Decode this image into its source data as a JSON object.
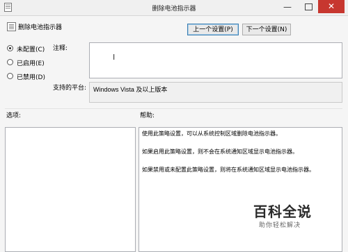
{
  "window": {
    "title": "删除电池指示器",
    "minimize_glyph": "—",
    "close_glyph": "✕"
  },
  "header": {
    "policy_name": "删除电池指示器",
    "prev_button": "上一个设置(P)",
    "next_button": "下一个设置(N)"
  },
  "state": {
    "options": [
      {
        "label": "未配置(C)",
        "selected": true
      },
      {
        "label": "已启用(E)",
        "selected": false
      },
      {
        "label": "已禁用(D)",
        "selected": false
      }
    ]
  },
  "comment": {
    "label": "注释:",
    "value": "",
    "cursor_glyph": "I"
  },
  "platform": {
    "label": "支持的平台:",
    "value": "Windows Vista 及以上版本"
  },
  "options_section": {
    "label": "选项:"
  },
  "help_section": {
    "label": "帮助:",
    "paragraphs": [
      "使用此策略设置，可以从系统控制区域删除电池指示器。",
      "如果启用此策略设置，则不会在系统通知区域显示电池指示器。",
      "如果禁用或未配置此策略设置，则将在系统通知区域显示电池指示器。"
    ]
  },
  "watermark": {
    "brand": "百科全说",
    "slogan": "助你轻松解决"
  }
}
